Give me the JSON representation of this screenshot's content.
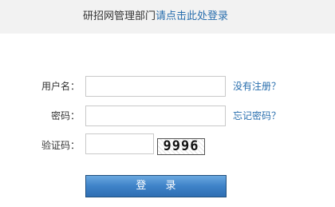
{
  "header": {
    "prefix": "研招网管理部门",
    "link_text": "请点击此处登录"
  },
  "form": {
    "username_label": "用户名：",
    "password_label": "密码：",
    "captcha_label": "验证码：",
    "username_value": "",
    "password_value": "",
    "captcha_value": "",
    "captcha_code": "9996",
    "register_link": "没有注册？",
    "forgot_link": "忘记密码？",
    "login_button": "登 录"
  },
  "colors": {
    "header_background": "#f2f2f2",
    "link": "#2a6fae",
    "button_top": "#6aa8e0",
    "button_bottom": "#2f6fb3"
  }
}
